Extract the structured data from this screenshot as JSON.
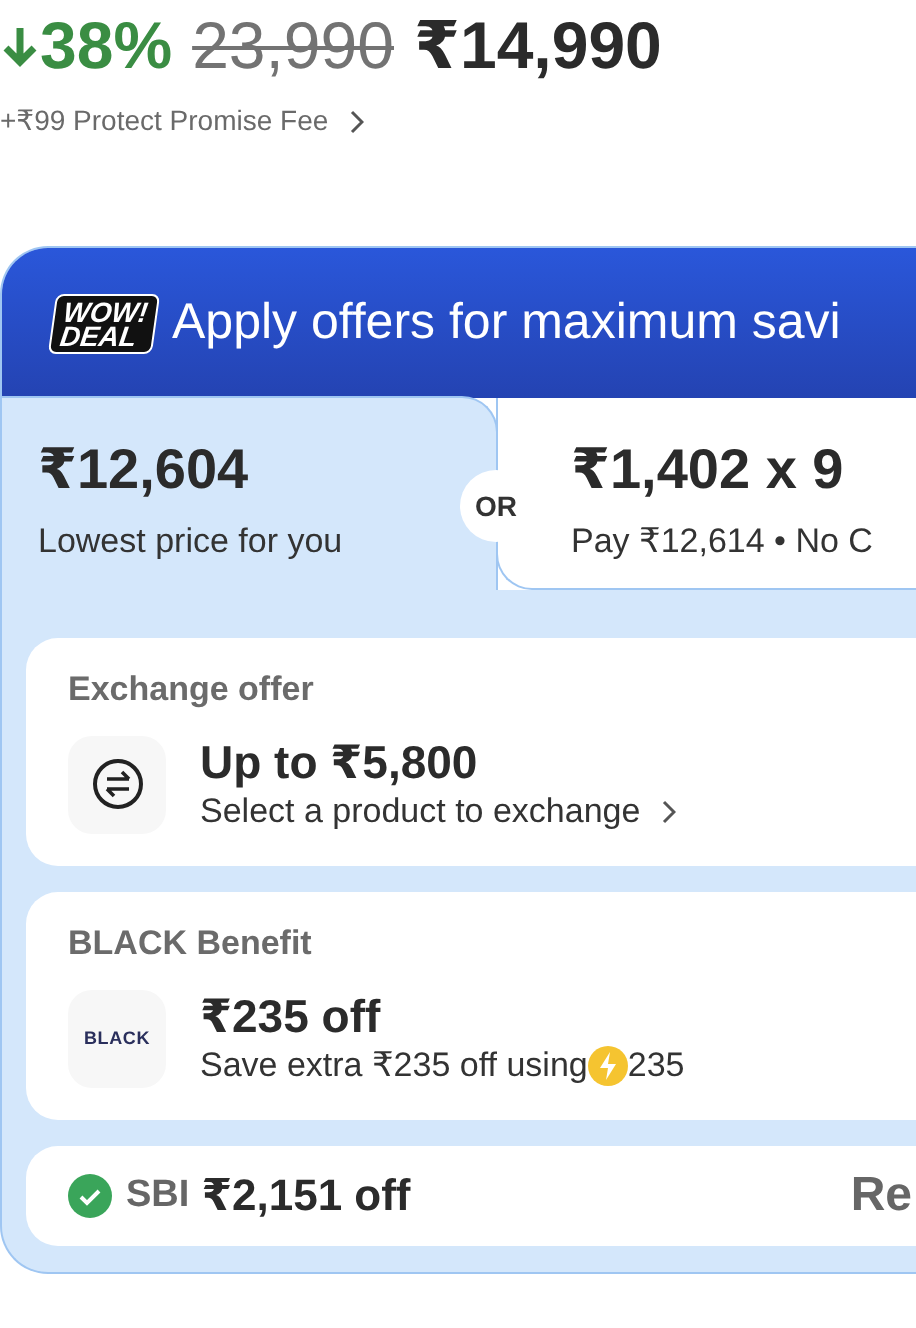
{
  "price": {
    "discount": "38%",
    "mrp": "23,990",
    "final": "₹14,990",
    "fee": "+₹99 Protect Promise Fee"
  },
  "offers_panel": {
    "logo": [
      "WOW!",
      "DEAL"
    ],
    "title": "Apply offers for maximum savi",
    "best_price": {
      "amount": "₹12,604",
      "caption": "Lowest price for you"
    },
    "separator": "OR",
    "emi": {
      "amount": "₹1,402 x 9",
      "caption": "Pay ₹12,614 • No C"
    },
    "cards": [
      {
        "kind": "exchange",
        "heading": "Exchange offer",
        "title": "Up to ₹5,800",
        "subtitle": "Select a product to exchange"
      },
      {
        "kind": "black",
        "heading": "BLACK Benefit",
        "logo_text": "BLACK",
        "title": "₹235 off",
        "subtitle": "Save extra ₹235 off using",
        "coin_amount": "235"
      },
      {
        "kind": "bank",
        "bank": "SBI",
        "title": "₹2,151 off",
        "action": "Re"
      }
    ]
  }
}
